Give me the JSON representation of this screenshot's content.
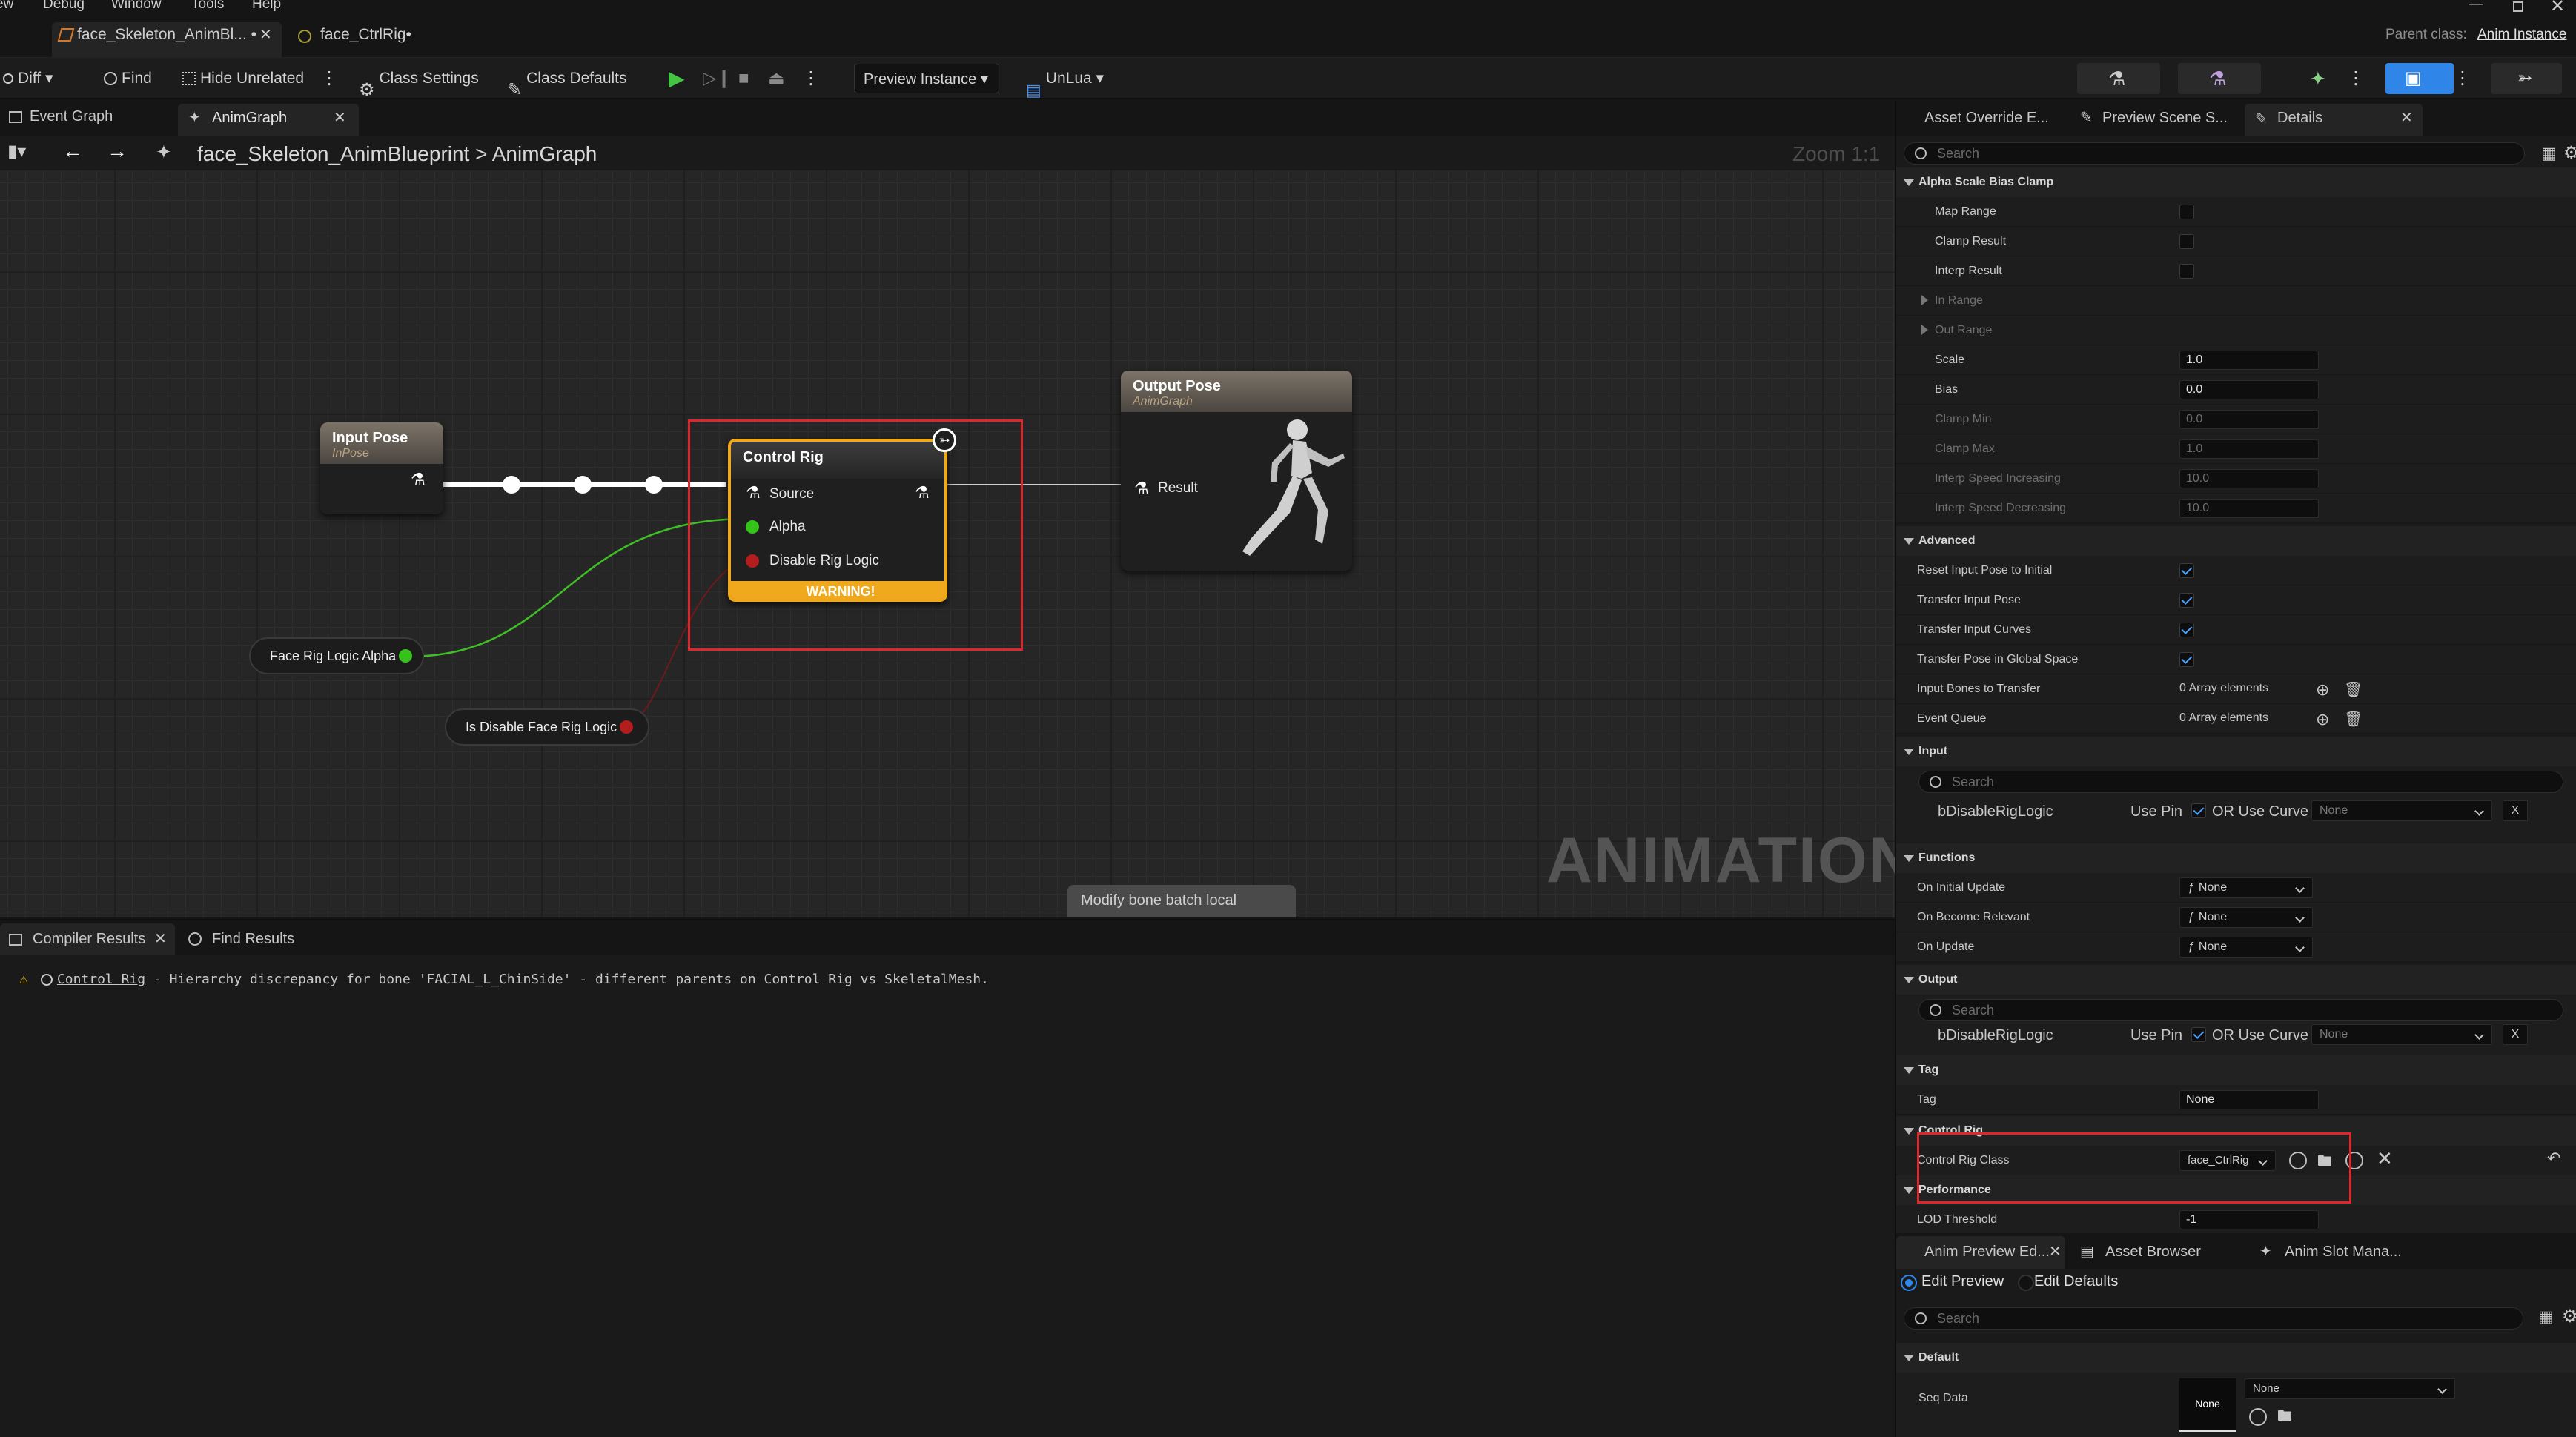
{
  "menu": [
    "ew",
    "Debug",
    "Window",
    "Tools",
    "Help"
  ],
  "doc_tabs": [
    {
      "label": "face_Skeleton_AnimBl... •",
      "active": true
    },
    {
      "label": "face_CtrlRig•",
      "active": false
    }
  ],
  "parent_class": {
    "label": "Parent class:",
    "value": "Anim Instance"
  },
  "toolbar": {
    "diff": "Diff",
    "find": "Find",
    "hide_unrelated": "Hide Unrelated",
    "class_settings": "Class Settings",
    "class_defaults": "Class Defaults",
    "preview_instance": "Preview Instance",
    "unlua": "UnLua"
  },
  "graph_tabs": [
    {
      "label": "Event Graph"
    },
    {
      "label": "AnimGraph"
    }
  ],
  "breadcrumb": {
    "asset": "face_Skeleton_AnimBlueprint",
    "sep": ">",
    "graph": "AnimGraph",
    "zoom": "Zoom 1:1"
  },
  "nodes": {
    "input_pose": {
      "title": "Input Pose",
      "subtitle": "InPose"
    },
    "control_rig": {
      "title": "Control Rig",
      "pins": [
        "Source",
        "Alpha",
        "Disable Rig Logic"
      ],
      "warning": "WARNING!"
    },
    "output_pose": {
      "title": "Output Pose",
      "subtitle": "AnimGraph",
      "pin": "Result"
    },
    "face_alpha": "Face Rig Logic Alpha",
    "disable_logic": "Is Disable Face Rig Logic",
    "modify_bone": "Modify bone batch local"
  },
  "watermark": "ANIMATION",
  "compiler": {
    "tabs": [
      "Compiler Results",
      "Find Results"
    ],
    "message_link": "Control Rig",
    "message": " - Hierarchy discrepancy for bone 'FACIAL_L_ChinSide' - different parents on Control Rig vs SkeletalMesh."
  },
  "right_tabs": [
    "Asset Override E...",
    "Preview Scene S...",
    "Details"
  ],
  "details": {
    "search_placeholder": "Search",
    "alpha_scale_bias_clamp": "Alpha Scale Bias Clamp",
    "map_range": "Map Range",
    "clamp_result": "Clamp Result",
    "interp_result": "Interp Result",
    "in_range": "In Range",
    "out_range": "Out Range",
    "scale": {
      "label": "Scale",
      "value": "1.0"
    },
    "bias": {
      "label": "Bias",
      "value": "0.0"
    },
    "clamp_min": {
      "label": "Clamp Min",
      "value": "0.0"
    },
    "clamp_max": {
      "label": "Clamp Max",
      "value": "1.0"
    },
    "interp_inc": {
      "label": "Interp Speed Increasing",
      "value": "10.0"
    },
    "interp_dec": {
      "label": "Interp Speed Decreasing",
      "value": "10.0"
    },
    "advanced": "Advanced",
    "reset_input": "Reset Input Pose to Initial",
    "transfer_pose": "Transfer Input Pose",
    "transfer_curves": "Transfer Input Curves",
    "transfer_global": "Transfer Pose in Global Space",
    "input_bones": {
      "label": "Input Bones to Transfer",
      "value": "0 Array elements"
    },
    "event_queue": {
      "label": "Event Queue",
      "value": "0 Array elements"
    },
    "input": "Input",
    "bdisable_in": {
      "label": "bDisableRigLogic",
      "use_pin": "Use Pin",
      "or_curve": "OR Use Curve",
      "curve": "None",
      "x": "X"
    },
    "functions": "Functions",
    "on_initial_update": {
      "label": "On Initial Update",
      "value": "None"
    },
    "on_become_relevant": {
      "label": "On Become Relevant",
      "value": "None"
    },
    "on_update": {
      "label": "On Update",
      "value": "None"
    },
    "output": "Output",
    "bdisable_out": {
      "label": "bDisableRigLogic",
      "use_pin": "Use Pin",
      "or_curve": "OR Use Curve",
      "curve": "None",
      "x": "X"
    },
    "tag_cat": "Tag",
    "tag": {
      "label": "Tag",
      "value": "None"
    },
    "control_rig_cat": "Control Rig",
    "control_rig_class": {
      "label": "Control Rig Class",
      "value": "face_CtrlRig"
    },
    "performance": "Performance",
    "lod_threshold": {
      "label": "LOD Threshold",
      "value": "-1"
    }
  },
  "bottom_tabs": [
    "Anim Preview Ed...",
    "Asset Browser",
    "Anim Slot Mana..."
  ],
  "preview": {
    "edit_preview": "Edit Preview",
    "edit_defaults": "Edit Defaults",
    "search": "Search",
    "default_cat": "Default",
    "seq_data": "Seq Data",
    "seq_none": "None",
    "combo_none": "None"
  },
  "colors": {
    "highlight_red": "#e0262a",
    "warning_yellow": "#f0a91c",
    "alpha_pin": "#35c21b",
    "disable_pin": "#b41d1d",
    "accent_blue": "#2f86e8"
  }
}
